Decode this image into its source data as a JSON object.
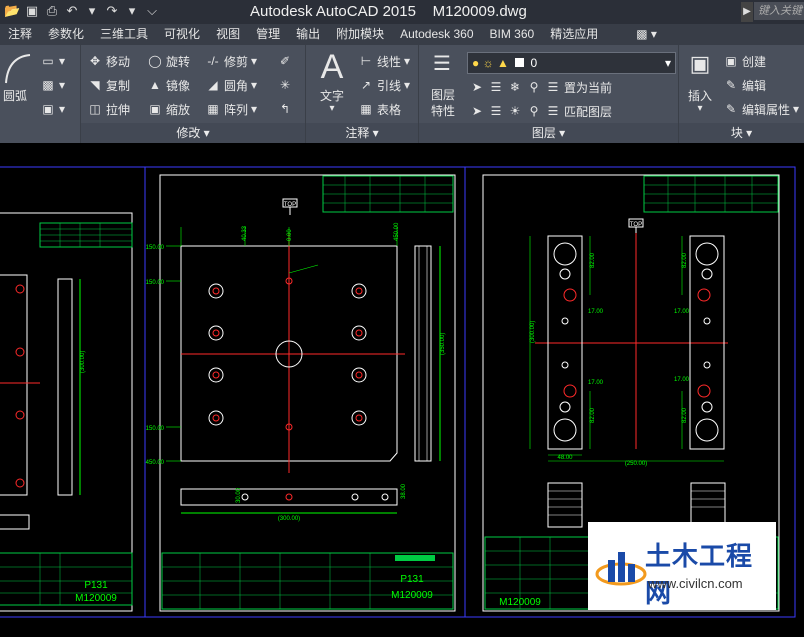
{
  "window": {
    "title": "Autodesk AutoCAD 2015    M120009.dwg",
    "search_placeholder": "键入关键"
  },
  "tabs": [
    "注释",
    "参数化",
    "三维工具",
    "可视化",
    "视图",
    "管理",
    "输出",
    "附加模块",
    "Autodesk 360",
    "BIM 360",
    "精选应用"
  ],
  "modify_panel": {
    "title": "修改",
    "arc_label": "圆弧",
    "items": [
      "移动",
      "旋转",
      "修剪",
      "复制",
      "镜像",
      "圆角",
      "拉伸",
      "缩放",
      "阵列"
    ]
  },
  "annotation_panel": {
    "title": "注释",
    "text_label": "文字",
    "items": [
      "线性",
      "引线",
      "表格"
    ]
  },
  "layers_panel": {
    "title": "图层",
    "props_label": "图层\n特性",
    "current_layer": "0",
    "items": [
      "置为当前",
      "匹配图层"
    ]
  },
  "block_panel": {
    "title": "块",
    "insert_label": "插入",
    "items": [
      "创建",
      "编辑",
      "编辑属性"
    ]
  },
  "drawing": {
    "sheet_codes": [
      "P131",
      "P131"
    ],
    "sheet_numbers": [
      "M120009",
      "M120009",
      "M120009"
    ],
    "top_tags": [
      "TOP",
      "TOP"
    ],
    "dims_mid": [
      "150.00",
      "150.00",
      "150.00",
      "450.00",
      "40.33",
      "0.00",
      "450.00",
      "(350.00)",
      "(300.00)",
      "38.00",
      "30.00",
      "10.00"
    ],
    "dims_right": [
      "82.00",
      "82.00",
      "82.00",
      "82.00",
      "17.00",
      "17.00",
      "17.00",
      "17.00",
      "48.00",
      "(250.00)",
      "(300.00)"
    ]
  },
  "watermark": {
    "title": "土木工程网",
    "url": "www.civilcn.com"
  },
  "colors": {
    "frame": "#3b3bff",
    "dim": "#00ff00",
    "axis": "#ff2a2a",
    "part": "#ffffff",
    "table": "#00cc44",
    "ribbon": "#4a505c"
  }
}
